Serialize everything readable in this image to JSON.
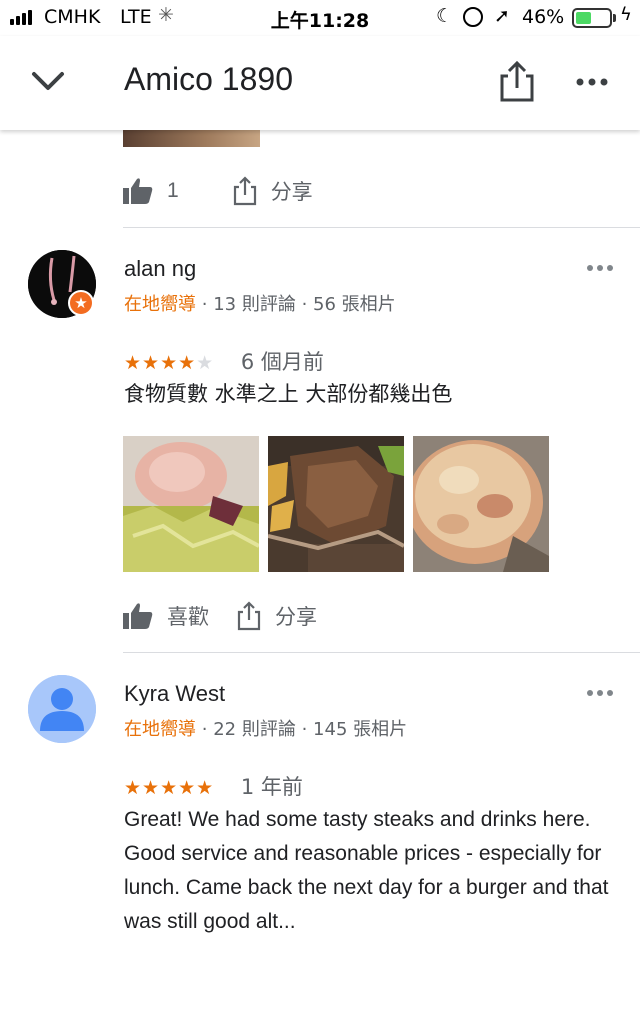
{
  "status_bar": {
    "carrier": "CMHK",
    "network": "LTE",
    "time": "上午11:28",
    "battery_percent": "46%",
    "battery_level": 0.46,
    "battery_color": "#4cd964"
  },
  "header": {
    "title": "Amico 1890",
    "back_icon": "chevron-down-icon",
    "share_icon": "share-icon",
    "more_icon": "more-horizontal-icon"
  },
  "previous_review": {
    "like_count": "1",
    "share_label": "分享"
  },
  "reviews": [
    {
      "name": "alan ng",
      "guide_label": "在地嚮導",
      "reviews_count": "13 則評論",
      "photos_count": "56 張相片",
      "stars_filled": "★★★★",
      "stars_empty": "★",
      "rating": 4,
      "time_ago": "6 個月前",
      "text": "食物質數 水準之上 大部份都幾出色",
      "like_label": "喜歡",
      "share_label": "分享"
    },
    {
      "name": "Kyra West",
      "guide_label": "在地嚮導",
      "reviews_count": "22 則評論",
      "photos_count": "145 張相片",
      "stars_filled": "★★★★★",
      "stars_empty": "",
      "rating": 5,
      "time_ago": "1 年前",
      "text": "Great! We had some tasty steaks and drinks here. Good service and reasonable prices - especially for lunch. Came back the next day for a burger and that was still good alt..."
    }
  ],
  "separator": "·",
  "colors": {
    "accent": "#e8710a",
    "badge": "#f36c21",
    "avatar_bg": "#a8c7fa",
    "avatar_fg": "#4285f4"
  }
}
